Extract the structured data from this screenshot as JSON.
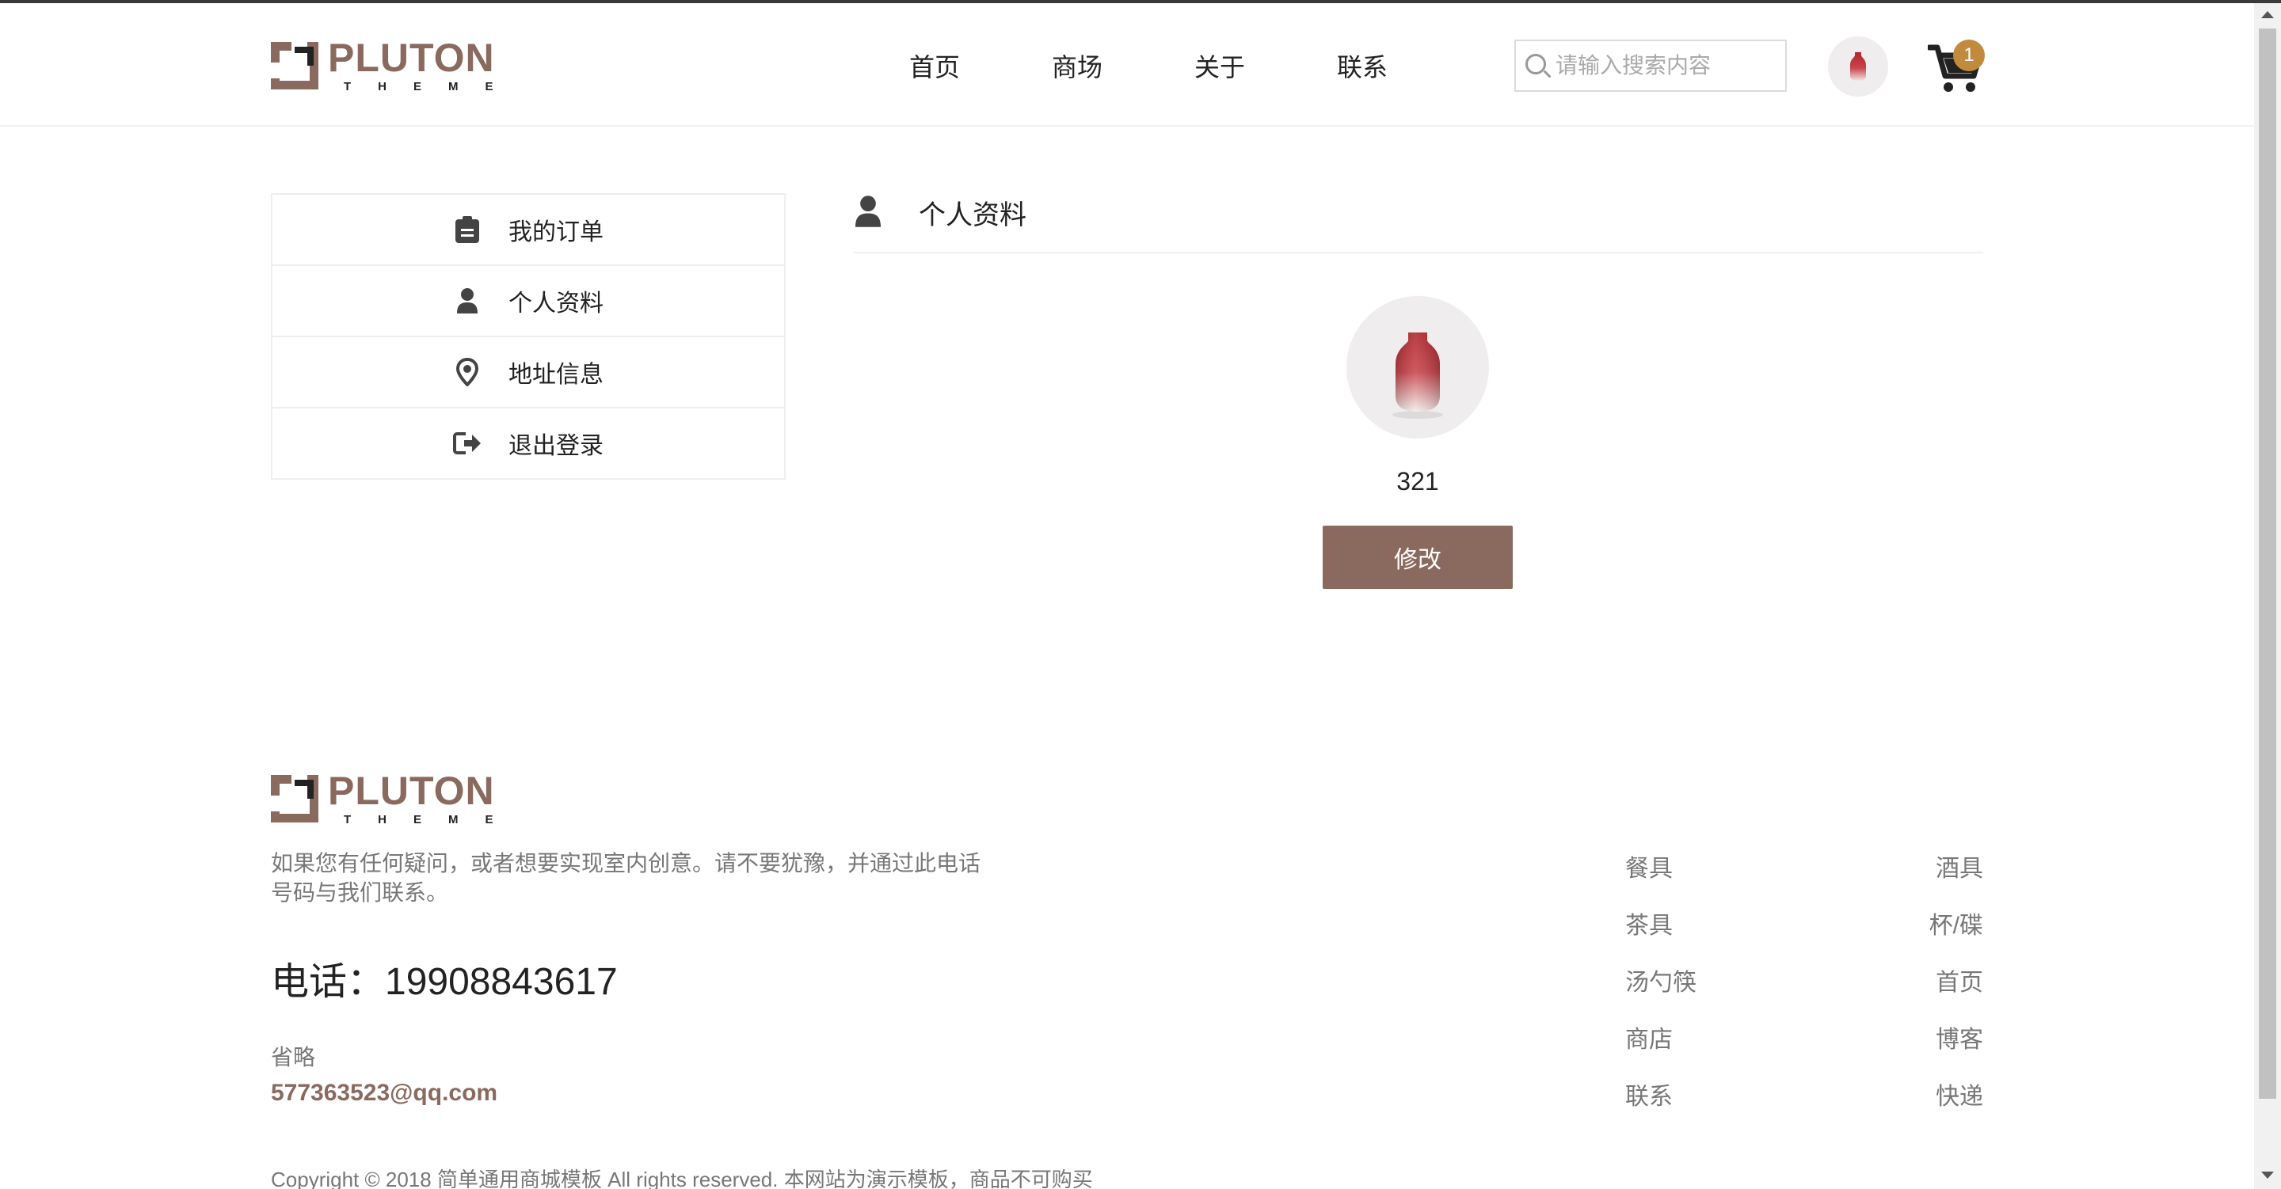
{
  "colors": {
    "brand": "#8a6a5e",
    "badge": "#c18a3c",
    "text": "#222222",
    "muted": "#777777"
  },
  "logo": {
    "word": "PLUTON",
    "sub": "THEME"
  },
  "nav": [
    {
      "label": "首页"
    },
    {
      "label": "商场"
    },
    {
      "label": "关于"
    },
    {
      "label": "联系"
    }
  ],
  "search": {
    "placeholder": "请输入搜索内容",
    "value": "",
    "icon": "search-icon"
  },
  "cart": {
    "count": "1",
    "icon": "cart-icon"
  },
  "sidebar": {
    "items": [
      {
        "label": "我的订单",
        "icon": "clipboard-icon"
      },
      {
        "label": "个人资料",
        "icon": "user-icon"
      },
      {
        "label": "地址信息",
        "icon": "map-pin-icon"
      },
      {
        "label": "退出登录",
        "icon": "logout-icon"
      }
    ]
  },
  "profile": {
    "title": "个人资料",
    "icon": "user-icon",
    "username": "321",
    "edit_label": "修改"
  },
  "footer": {
    "description": "如果您有任何疑问，或者想要实现室内创意。请不要犹豫，并通过此电话号码与我们联系。",
    "phone": "电话：19908843617",
    "omit": "省略",
    "email": "577363523@qq.com",
    "links": [
      [
        "餐具",
        "酒具"
      ],
      [
        "茶具",
        "杯/碟"
      ],
      [
        "汤勺筷",
        "首页"
      ],
      [
        "商店",
        "博客"
      ],
      [
        "联系",
        "快递"
      ]
    ],
    "copyright": "Copyright © 2018 简单通用商城模板 All rights reserved. 本网站为演示模板，商品不可购买"
  }
}
